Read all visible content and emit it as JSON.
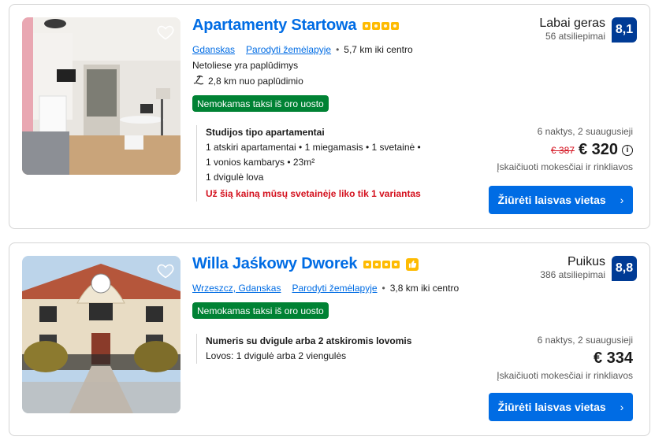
{
  "listings": [
    {
      "name": "Apartamenty Startowa",
      "stars": 4,
      "location": "Gdanskas",
      "map_link": "Parodyti žemėlapyje",
      "distance": "5,7 km iki centro",
      "beach_note": "Netoliese yra paplūdimys",
      "beach_distance": "2,8 km nuo paplūdimio",
      "taxi_badge": "Nemokamas taksi iš oro uosto",
      "room_title": "Studijos tipo apartamentai",
      "room_lines": [
        "1 atskiri apartamentai • 1 miegamasis • 1 svetainė •",
        "1 vonios kambarys • 23m²",
        "1 dvigulė lova"
      ],
      "warning": "Už šią kainą mūsų svetainėje liko tik 1 variantas",
      "review_word": "Labai geras",
      "review_count": "56 atsiliepimai",
      "score": "8,1",
      "stay_info": "6 naktys, 2 suaugusieji",
      "old_price": "€ 387",
      "price": "€ 320",
      "tax_note": "Įskaičiuoti mokesčiai ir rinkliavos",
      "cta": "Žiūrėti laisvas vietas"
    },
    {
      "name": "Willa Jaśkowy Dworek",
      "stars": 4,
      "location": "Wrzeszcz, Gdanskas",
      "map_link": "Parodyti žemėlapyje",
      "distance": "3,8 km iki centro",
      "taxi_badge": "Nemokamas taksi iš oro uosto",
      "room_title": "Numeris su dvigule arba 2 atskiromis lovomis",
      "room_lines": [
        "Lovos: 1 dvigulė arba 2 viengulės"
      ],
      "review_word": "Puikus",
      "review_count": "386 atsiliepimai",
      "score": "8,8",
      "stay_info": "6 naktys, 2 suaugusieji",
      "price": "€ 334",
      "tax_note": "Įskaičiuoti mokesčiai ir rinkliavos",
      "cta": "Žiūrėti laisvas vietas"
    }
  ],
  "colors": {
    "link": "#006ce4",
    "score_bg": "#003b95",
    "badge_green": "#008234",
    "warning": "#d4111e",
    "star": "#febb02"
  },
  "icons": {
    "heart": "heart-icon",
    "beach": "beach-icon",
    "info": "info-icon",
    "chevron": "chevron-right-icon",
    "thumb": "thumbs-up-icon"
  }
}
